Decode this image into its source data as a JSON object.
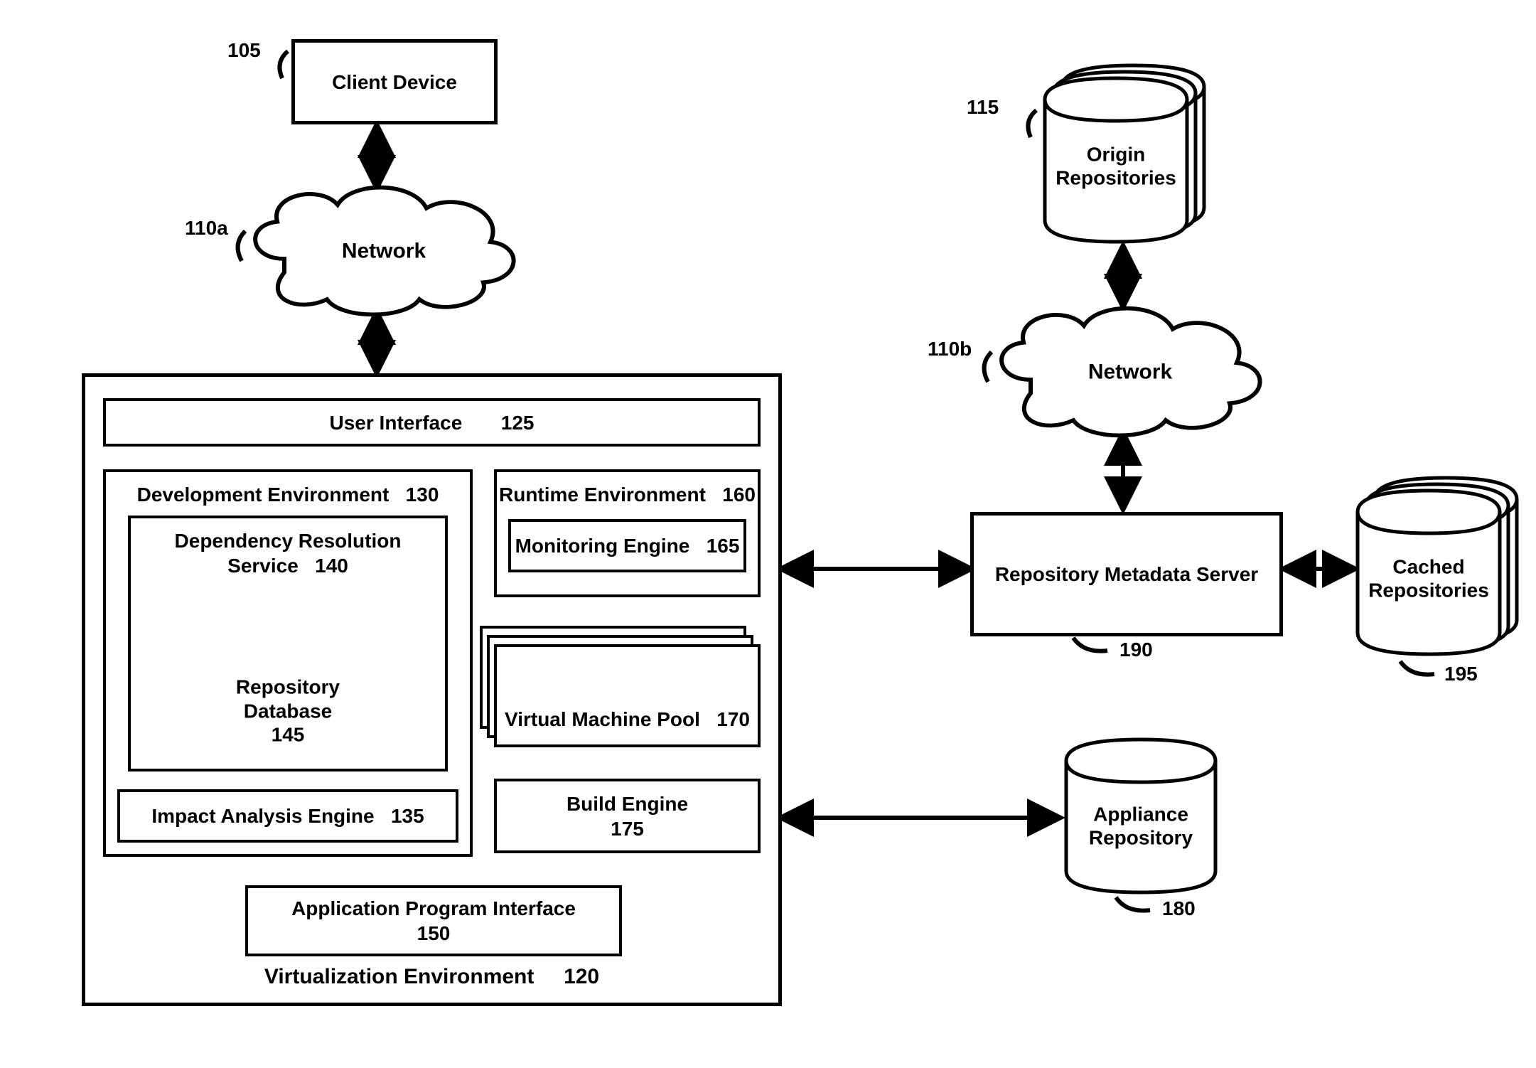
{
  "refs": {
    "client_device": "105",
    "network_a": "110a",
    "network_b": "110b",
    "origin_repos": "115",
    "virtualization_env": "120",
    "user_interface": "125",
    "dev_env": "130",
    "impact_engine": "135",
    "dep_res_service": "140",
    "repo_db": "145",
    "api": "150",
    "runtime_env": "160",
    "monitoring_engine": "165",
    "vm_pool": "170",
    "build_engine": "175",
    "appliance_repo": "180",
    "repo_meta_server": "190",
    "cached_repos": "195"
  },
  "labels": {
    "client_device": "Client Device",
    "network": "Network",
    "origin_repos_l1": "Origin",
    "origin_repos_l2": "Repositories",
    "virtualization_env": "Virtualization Environment",
    "user_interface": "User Interface",
    "dev_env": "Development Environment",
    "impact_engine": "Impact Analysis Engine",
    "dep_res_service_l1": "Dependency Resolution",
    "dep_res_service_l2": "Service",
    "repo_db_l1": "Repository",
    "repo_db_l2": "Database",
    "api_l1": "Application Program Interface",
    "runtime_env": "Runtime Environment",
    "monitoring_engine": "Monitoring Engine",
    "vm_pool": "Virtual Machine Pool",
    "build_engine": "Build Engine",
    "appliance_repo_l1": "Appliance",
    "appliance_repo_l2": "Repository",
    "repo_meta_server": "Repository Metadata Server",
    "cached_repos_l1": "Cached",
    "cached_repos_l2": "Repositories"
  }
}
